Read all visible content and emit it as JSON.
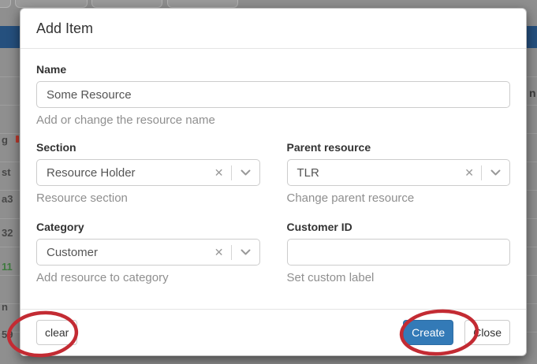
{
  "background": {
    "left_fragments": [
      "g",
      "st",
      "a3",
      "32",
      "11",
      "n",
      "59"
    ],
    "right_fragment": "n"
  },
  "modal": {
    "title": "Add Item",
    "fields": {
      "name": {
        "label": "Name",
        "value": "Some Resource",
        "help": "Add or change the resource name"
      },
      "section": {
        "label": "Section",
        "value": "Resource Holder",
        "help": "Resource section"
      },
      "parent": {
        "label": "Parent resource",
        "value": "TLR",
        "help": "Change parent resource"
      },
      "category": {
        "label": "Category",
        "value": "Customer",
        "help": "Add resource to category"
      },
      "customer_id": {
        "label": "Customer ID",
        "value": "",
        "help": "Set custom label"
      }
    },
    "icons": {
      "clear_glyph": "✕"
    },
    "footer": {
      "clear": "clear",
      "create": "Create",
      "close": "Close"
    }
  },
  "colors": {
    "primary_button": "#337ab7",
    "annotation_red": "#c32b33",
    "behind_header_bar": "#25507e"
  }
}
